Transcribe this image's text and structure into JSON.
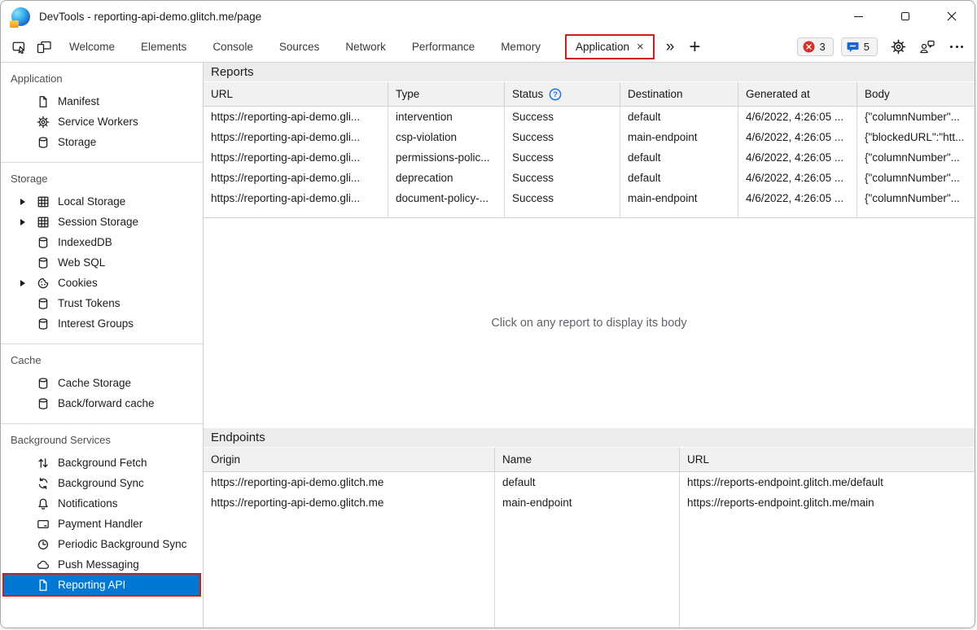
{
  "window": {
    "title": "DevTools - reporting-api-demo.glitch.me/page"
  },
  "toolbar": {
    "tabs": [
      "Welcome",
      "Elements",
      "Console",
      "Sources",
      "Network",
      "Performance",
      "Memory"
    ],
    "application_tab": "Application",
    "close_tab_glyph": "×",
    "more_tabs_glyph": "»",
    "add_tab_glyph": "+",
    "error_count": "3",
    "issues_count": "5"
  },
  "sidebar": {
    "application": {
      "title": "Application",
      "items": [
        "Manifest",
        "Service Workers",
        "Storage"
      ]
    },
    "storage": {
      "title": "Storage",
      "items": [
        "Local Storage",
        "Session Storage",
        "IndexedDB",
        "Web SQL",
        "Cookies",
        "Trust Tokens",
        "Interest Groups"
      ]
    },
    "cache": {
      "title": "Cache",
      "items": [
        "Cache Storage",
        "Back/forward cache"
      ]
    },
    "background": {
      "title": "Background Services",
      "items": [
        "Background Fetch",
        "Background Sync",
        "Notifications",
        "Payment Handler",
        "Periodic Background Sync",
        "Push Messaging",
        "Reporting API"
      ]
    }
  },
  "reports": {
    "title": "Reports",
    "columns": [
      "URL",
      "Type",
      "Status",
      "Destination",
      "Generated at",
      "Body"
    ],
    "rows": [
      {
        "url": "https://reporting-api-demo.gli...",
        "type": "intervention",
        "status": "Success",
        "destination": "default",
        "generated_at": "4/6/2022, 4:26:05 ...",
        "body": "{\"columnNumber\"..."
      },
      {
        "url": "https://reporting-api-demo.gli...",
        "type": "csp-violation",
        "status": "Success",
        "destination": "main-endpoint",
        "generated_at": "4/6/2022, 4:26:05 ...",
        "body": "{\"blockedURL\":\"htt..."
      },
      {
        "url": "https://reporting-api-demo.gli...",
        "type": "permissions-polic...",
        "status": "Success",
        "destination": "default",
        "generated_at": "4/6/2022, 4:26:05 ...",
        "body": "{\"columnNumber\"..."
      },
      {
        "url": "https://reporting-api-demo.gli...",
        "type": "deprecation",
        "status": "Success",
        "destination": "default",
        "generated_at": "4/6/2022, 4:26:05 ...",
        "body": "{\"columnNumber\"..."
      },
      {
        "url": "https://reporting-api-demo.gli...",
        "type": "document-policy-...",
        "status": "Success",
        "destination": "main-endpoint",
        "generated_at": "4/6/2022, 4:26:05 ...",
        "body": "{\"columnNumber\"..."
      }
    ],
    "placeholder": "Click on any report to display its body"
  },
  "endpoints": {
    "title": "Endpoints",
    "columns": [
      "Origin",
      "Name",
      "URL"
    ],
    "rows": [
      {
        "origin": "https://reporting-api-demo.glitch.me",
        "name": "default",
        "url": "https://reports-endpoint.glitch.me/default"
      },
      {
        "origin": "https://reporting-api-demo.glitch.me",
        "name": "main-endpoint",
        "url": "https://reports-endpoint.glitch.me/main"
      }
    ]
  },
  "colors": {
    "accent_blue": "#0078d4",
    "annotation_red": "#d01f1a",
    "error_red": "#d93025",
    "issues_blue": "#1767d2",
    "help_blue": "#1a73e8"
  }
}
